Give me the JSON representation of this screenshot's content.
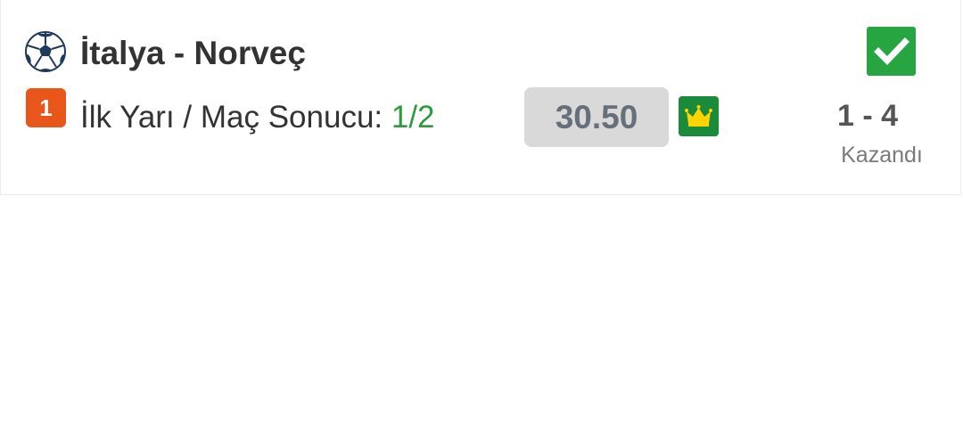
{
  "bet": {
    "sport_icon": "soccer-ball-icon",
    "match_title": "İtalya - Norveç",
    "order_number": "1",
    "market_label": "İlk Yarı / Maç Sonucu: ",
    "market_pick": "1/2",
    "odds": "30.50",
    "crown_icon": "crown-icon",
    "result_icon": "check-icon",
    "score": "1 - 4",
    "status": "Kazandı"
  },
  "colors": {
    "order_badge": "#e8561a",
    "pick_green": "#2e9a3e",
    "check_green": "#27a540",
    "crown_green": "#1a8a3b",
    "crown_yellow": "#ffd400",
    "odds_bg": "#d9d9d9"
  }
}
